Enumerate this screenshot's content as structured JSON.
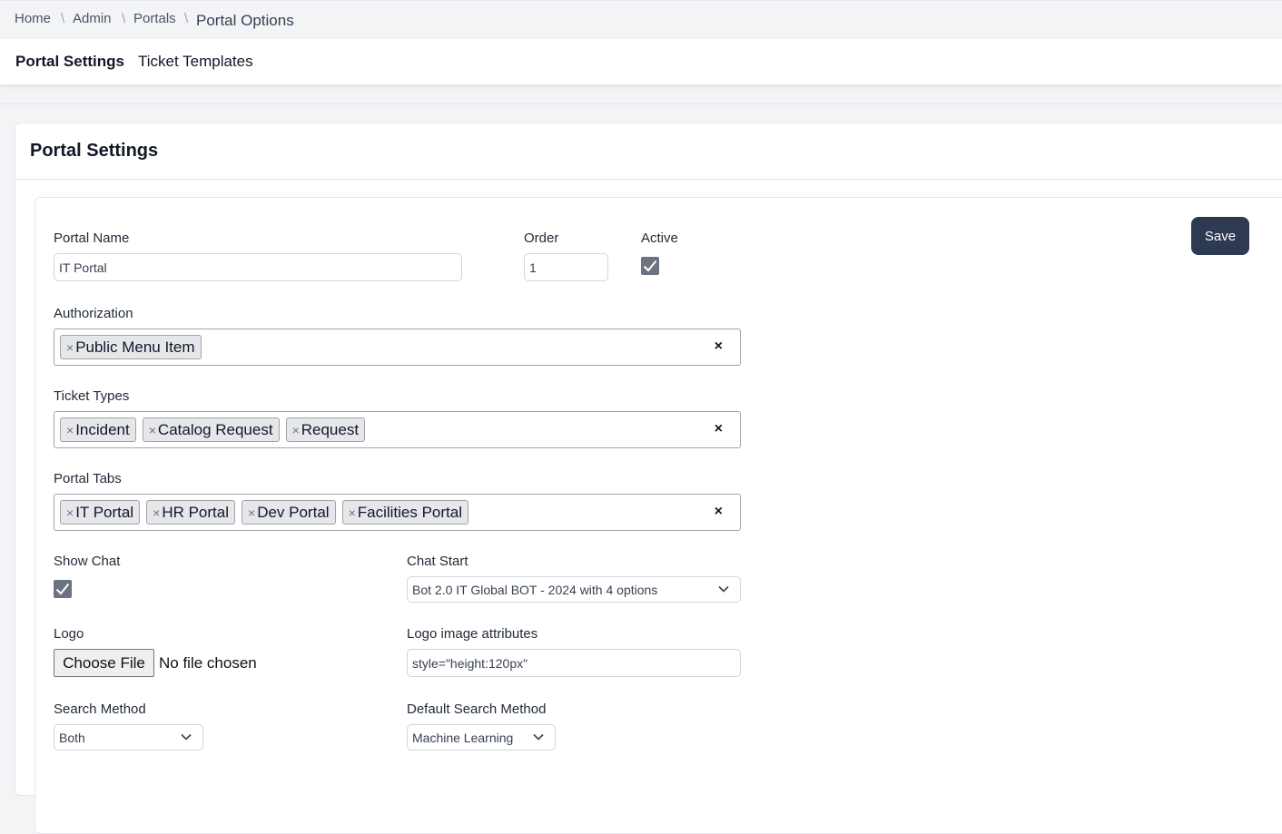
{
  "breadcrumb": {
    "items": [
      "Home",
      "Admin",
      "Portals"
    ],
    "current": "Portal Options",
    "separator": "\\"
  },
  "tabs": [
    "Portal Settings",
    "Ticket Templates"
  ],
  "card": {
    "title": "Portal Settings"
  },
  "form": {
    "save_label": "Save",
    "portal_name": {
      "label": "Portal Name",
      "value": "IT Portal"
    },
    "order": {
      "label": "Order",
      "value": "1"
    },
    "active": {
      "label": "Active",
      "checked": true
    },
    "authorization": {
      "label": "Authorization",
      "tags": [
        "Public Menu Item"
      ]
    },
    "ticket_types": {
      "label": "Ticket Types",
      "tags": [
        "Incident",
        "Catalog Request",
        "Request"
      ]
    },
    "portal_tabs": {
      "label": "Portal Tabs",
      "tags": [
        "IT Portal",
        "HR Portal",
        "Dev Portal",
        "Facilities Portal"
      ]
    },
    "show_chat": {
      "label": "Show Chat",
      "checked": true
    },
    "chat_start": {
      "label": "Chat Start",
      "value": "Bot 2.0 IT Global BOT - 2024 with 4 options"
    },
    "logo": {
      "label": "Logo",
      "button": "Choose File",
      "status": "No file chosen"
    },
    "logo_attrs": {
      "label": "Logo image attributes",
      "value": "style=\"height:120px\""
    },
    "search_method": {
      "label": "Search Method",
      "value": "Both"
    },
    "default_search_method": {
      "label": "Default Search Method",
      "value": "Machine Learning"
    },
    "tag_remove_glyph": "×",
    "clear_glyph": "×"
  },
  "colors": {
    "primary_button": "#2e3a52",
    "checkbox": "#6b7280"
  }
}
